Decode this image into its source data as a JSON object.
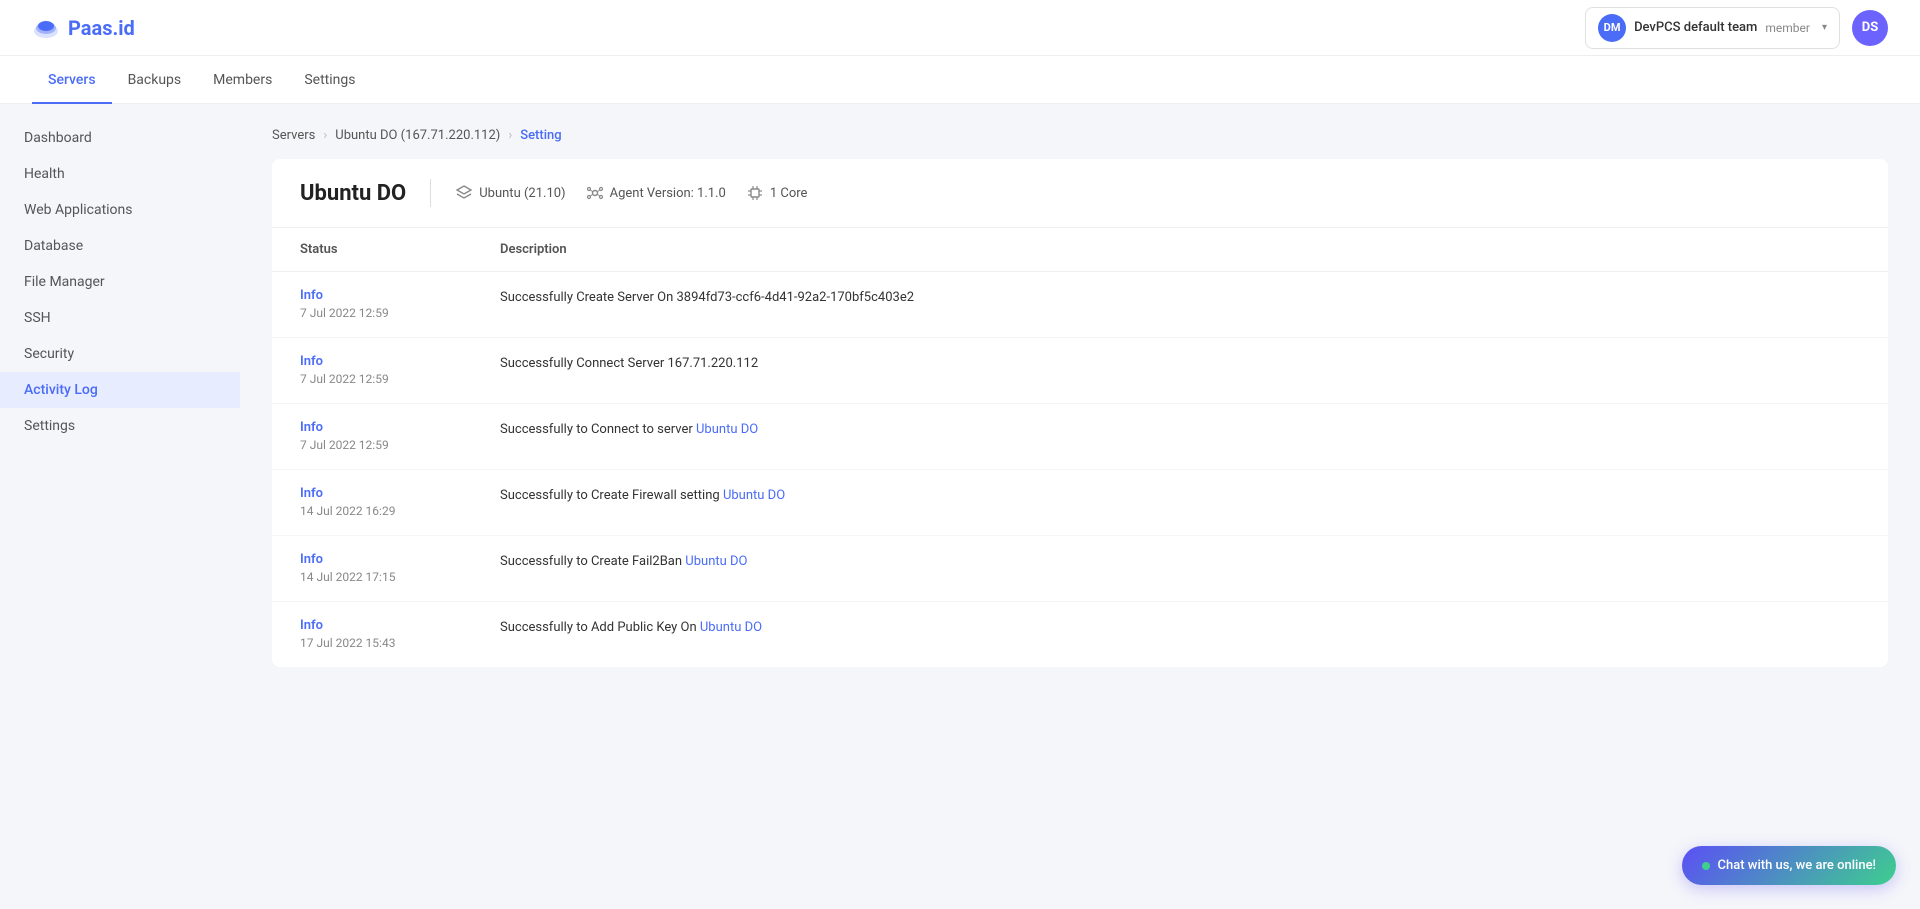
{
  "brand": {
    "name": "Paas.id",
    "logo_text": "Paas.id"
  },
  "topnav": {
    "team_initials": "DM",
    "team_name": "DevPCS default team",
    "team_role": "member",
    "user_initials": "DS"
  },
  "secondary_nav": {
    "tabs": [
      {
        "label": "Servers",
        "active": true
      },
      {
        "label": "Backups",
        "active": false
      },
      {
        "label": "Members",
        "active": false
      },
      {
        "label": "Settings",
        "active": false
      }
    ]
  },
  "sidebar": {
    "items": [
      {
        "label": "Dashboard",
        "active": false
      },
      {
        "label": "Health",
        "active": false
      },
      {
        "label": "Web Applications",
        "active": false
      },
      {
        "label": "Database",
        "active": false
      },
      {
        "label": "File Manager",
        "active": false
      },
      {
        "label": "SSH",
        "active": false
      },
      {
        "label": "Security",
        "active": false
      },
      {
        "label": "Activity Log",
        "active": true
      },
      {
        "label": "Settings",
        "active": false
      }
    ]
  },
  "breadcrumb": {
    "items": [
      {
        "label": "Servers",
        "link": true
      },
      {
        "label": "Ubuntu DO (167.71.220.112)",
        "link": true
      },
      {
        "label": "Setting",
        "current": true
      }
    ]
  },
  "server": {
    "name": "Ubuntu DO",
    "os": "Ubuntu (21.10)",
    "agent_version_label": "Agent Version: 1.1.0",
    "core_label": "1 Core"
  },
  "table": {
    "headers": [
      "Status",
      "Description"
    ],
    "rows": [
      {
        "status_label": "Info",
        "status_date": "7 Jul 2022 12:59",
        "description": "Successfully Create Server On 3894fd73-ccf6-4d41-92a2-170bf5c403e2",
        "has_highlight": false
      },
      {
        "status_label": "Info",
        "status_date": "7 Jul 2022 12:59",
        "description": "Successfully Connect Server 167.71.220.112",
        "has_highlight": false
      },
      {
        "status_label": "Info",
        "status_date": "7 Jul 2022 12:59",
        "description": "Successfully to Connect to server Ubuntu DO",
        "has_highlight": true,
        "highlight_word": "Ubuntu DO",
        "prefix": "Successfully to Connect to server "
      },
      {
        "status_label": "Info",
        "status_date": "14 Jul 2022 16:29",
        "description": "Successfully to Create Firewall setting Ubuntu DO",
        "has_highlight": true,
        "highlight_word": "Ubuntu DO",
        "prefix": "Successfully to Create Firewall setting "
      },
      {
        "status_label": "Info",
        "status_date": "14 Jul 2022 17:15",
        "description": "Successfully to Create Fail2Ban Ubuntu DO",
        "has_highlight": true,
        "highlight_word": "Ubuntu DO",
        "prefix": "Successfully to Create Fail2Ban "
      },
      {
        "status_label": "Info",
        "status_date": "17 Jul 2022 15:43",
        "description": "Successfully to Add Public Key On Ubuntu DO",
        "has_highlight": true,
        "highlight_word": "Ubuntu DO",
        "prefix": "Successfully to Add Public Key On "
      }
    ]
  },
  "chat_widget": {
    "label": "Chat with us, we are online!"
  }
}
